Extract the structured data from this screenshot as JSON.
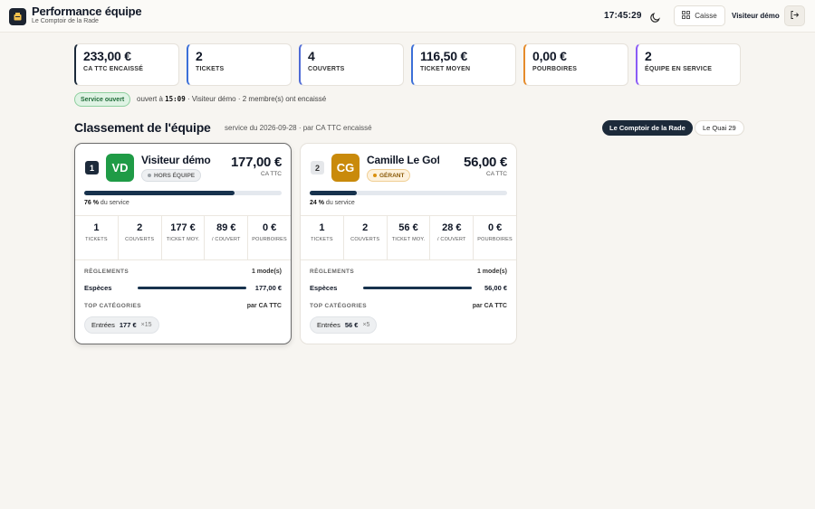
{
  "header": {
    "title": "Performance équipe",
    "subtitle": "Le Comptoir de la Rade",
    "clock": "17:45:29",
    "caisse_label": "Caisse",
    "user_name": "Visiteur démo"
  },
  "kpis": [
    {
      "value": "233,00 €",
      "label": "CA TTC ENCAISSÉ",
      "accent": "#1c2a3a"
    },
    {
      "value": "2",
      "label": "TICKETS",
      "accent": "#3b6fd8"
    },
    {
      "value": "4",
      "label": "COUVERTS",
      "accent": "#4f6bd6"
    },
    {
      "value": "116,50 €",
      "label": "TICKET MOYEN",
      "accent": "#3b6fd8"
    },
    {
      "value": "0,00 €",
      "label": "POURBOIRES",
      "accent": "#e58b2b"
    },
    {
      "value": "2",
      "label": "ÉQUIPE EN SERVICE",
      "accent": "#8b5cf6"
    }
  ],
  "status": {
    "badge": "Service ouvert",
    "opened_prefix": "ouvert à",
    "opened_time": "15:09",
    "opened_by": "· Visiteur démo",
    "members_note": "· 2 membre(s) ont encaissé"
  },
  "ranking": {
    "title": "Classement de l'équipe",
    "subtitle": "service du 2026-09-28 · par CA TTC encaissé",
    "tabs": [
      "Le Comptoir de la Rade",
      "Le Quai 29"
    ],
    "active_tab": "Le Comptoir de la Rade"
  },
  "members": [
    {
      "rank": "1",
      "initials": "VD",
      "avatar_color": "#1f9b46",
      "name": "Visiteur démo",
      "role": "HORS ÉQUIPE",
      "role_bg": "#eef0f2",
      "role_border": "#d9dde2",
      "role_color": "#666",
      "role_dot": "#9aa0a6",
      "amount": "177,00 €",
      "amount_label": "CA TTC",
      "share_pct": 76,
      "share_label": "76 %",
      "share_suffix": "du service",
      "stats": [
        {
          "value": "1",
          "label": "TICKETS"
        },
        {
          "value": "2",
          "label": "COUVERTS"
        },
        {
          "value": "177 €",
          "label": "TICKET MOY."
        },
        {
          "value": "89 €",
          "label": "/ COUVERT"
        },
        {
          "value": "0 €",
          "label": "POURBOIRES"
        }
      ],
      "payments_label": "RÈGLEMENTS",
      "payments_count": "1 mode(s)",
      "payment_name": "Espèces",
      "payment_amount": "177,00 €",
      "payment_share": 1.0,
      "top_label": "TOP CATÉGORIES",
      "top_right": "par CA TTC",
      "category_name": "Entrées",
      "category_amount": "177 €",
      "category_count": "×15"
    },
    {
      "rank": "2",
      "initials": "CG",
      "avatar_color": "#c98a0b",
      "name": "Camille Le Goff",
      "role": "GÉRANT",
      "role_bg": "#fdf1dc",
      "role_border": "#f0cf94",
      "role_color": "#8a5a08",
      "role_dot": "#d9900e",
      "amount": "56,00 €",
      "amount_label": "CA TTC",
      "share_pct": 24,
      "share_label": "24 %",
      "share_suffix": "du service",
      "stats": [
        {
          "value": "1",
          "label": "TICKETS"
        },
        {
          "value": "2",
          "label": "COUVERTS"
        },
        {
          "value": "56 €",
          "label": "TICKET MOY."
        },
        {
          "value": "28 €",
          "label": "/ COUVERT"
        },
        {
          "value": "0 €",
          "label": "POURBOIRES"
        }
      ],
      "payments_label": "RÈGLEMENTS",
      "payments_count": "1 mode(s)",
      "payment_name": "Espèces",
      "payment_amount": "56,00 €",
      "payment_share": 1.0,
      "top_label": "TOP CATÉGORIES",
      "top_right": "par CA TTC",
      "category_name": "Entrées",
      "category_amount": "56 €",
      "category_count": "×5"
    }
  ]
}
